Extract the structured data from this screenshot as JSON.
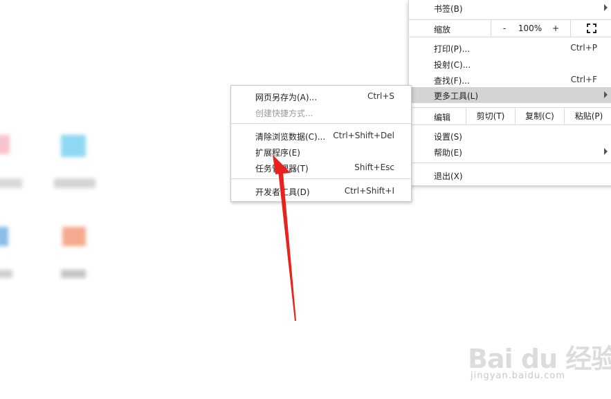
{
  "main_menu": {
    "bookmarks": "书签(B)",
    "zoom_label": "缩放",
    "zoom_minus": "-",
    "zoom_value": "100%",
    "zoom_plus": "+",
    "print": "打印(P)...",
    "print_shortcut": "Ctrl+P",
    "cast": "投射(C)...",
    "find": "查找(F)...",
    "find_shortcut": "Ctrl+F",
    "more_tools": "更多工具(L)",
    "edit_label": "编辑",
    "cut": "剪切(T)",
    "copy": "复制(C)",
    "paste": "粘贴(P)",
    "settings": "设置(S)",
    "help": "帮助(E)",
    "exit": "退出(X)"
  },
  "sub_menu": {
    "save_page": "网页另存为(A)...",
    "save_page_shortcut": "Ctrl+S",
    "create_shortcut": "创建快捷方式...",
    "clear_data": "清除浏览数据(C)...",
    "clear_data_shortcut": "Ctrl+Shift+Del",
    "extensions": "扩展程序(E)",
    "task_manager": "任务管理器(T)",
    "task_manager_shortcut": "Shift+Esc",
    "dev_tools": "开发者工具(D)",
    "dev_tools_shortcut": "Ctrl+Shift+I"
  },
  "icons": {
    "fullscreen": "fullscreen-icon",
    "submenu_arrow": "chevron-right-icon"
  },
  "colors": {
    "highlight": "#d4d4d4",
    "annotation_arrow": "#e8231f"
  },
  "watermark": {
    "brand": "Bai du 经验",
    "url": "jingyan.baidu.com"
  }
}
